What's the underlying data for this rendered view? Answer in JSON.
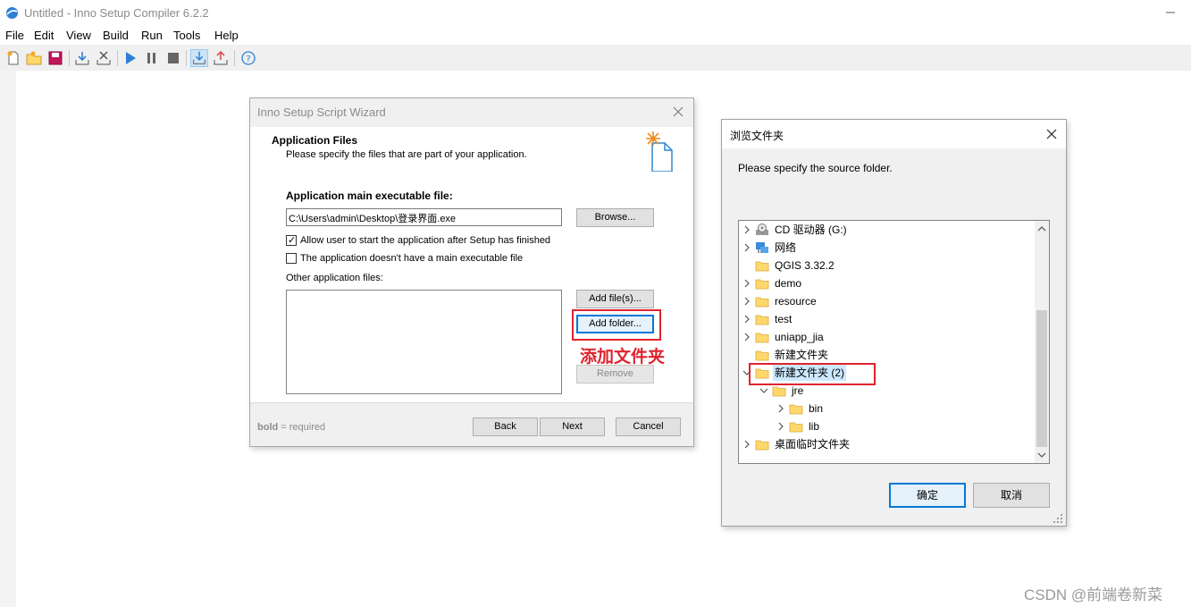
{
  "app": {
    "title": "Untitled - Inno Setup Compiler 6.2.2",
    "menu": [
      "File",
      "Edit",
      "View",
      "Build",
      "Run",
      "Tools",
      "Help"
    ],
    "toolbar_icons": [
      "new-file-icon",
      "open-folder-icon",
      "save-icon",
      "compile-icon",
      "stop-compile-icon",
      "run-icon",
      "pause-icon",
      "stop-icon",
      "load-icon",
      "upload-icon",
      "help-icon"
    ]
  },
  "wizard": {
    "title": "Inno Setup Script Wizard",
    "heading": "Application Files",
    "subheading": "Please specify the files that are part of your application.",
    "main_exe_label": "Application main executable file:",
    "main_exe_value": "C:\\Users\\admin\\Desktop\\登录界面.exe",
    "browse_button": "Browse...",
    "allow_start_label": "Allow user to start the application after Setup has finished",
    "allow_start_checked": true,
    "no_exe_label": "The application doesn't have a main executable file",
    "no_exe_checked": false,
    "other_files_label": "Other application files:",
    "add_files_button": "Add file(s)...",
    "add_folder_button": "Add folder...",
    "remove_button": "Remove",
    "annotation": "添加文件夹",
    "footer_bold": "bold",
    "footer_rest": " = required",
    "back_button": "Back",
    "next_button": "Next",
    "cancel_button": "Cancel"
  },
  "browse": {
    "title": "浏览文件夹",
    "prompt": "Please specify the source folder.",
    "tree": [
      {
        "label": "CD 驱动器 (G:)",
        "icon": "cd-drive-icon",
        "level": 0,
        "chevron": "right"
      },
      {
        "label": "网络",
        "icon": "network-icon",
        "level": 0,
        "chevron": "right"
      },
      {
        "label": "QGIS 3.32.2",
        "icon": "folder-icon",
        "level": 0,
        "chevron": ""
      },
      {
        "label": "demo",
        "icon": "folder-icon",
        "level": 0,
        "chevron": "right"
      },
      {
        "label": "resource",
        "icon": "folder-icon",
        "level": 0,
        "chevron": "right"
      },
      {
        "label": "test",
        "icon": "folder-icon",
        "level": 0,
        "chevron": "right"
      },
      {
        "label": "uniapp_jia",
        "icon": "folder-icon",
        "level": 0,
        "chevron": "right"
      },
      {
        "label": "新建文件夹",
        "icon": "folder-icon",
        "level": 0,
        "chevron": ""
      },
      {
        "label": "新建文件夹 (2)",
        "icon": "folder-icon",
        "level": 0,
        "chevron": "down",
        "selected": true
      },
      {
        "label": "jre",
        "icon": "folder-icon",
        "level": 1,
        "chevron": "down"
      },
      {
        "label": "bin",
        "icon": "folder-icon",
        "level": 2,
        "chevron": "right"
      },
      {
        "label": "lib",
        "icon": "folder-icon",
        "level": 2,
        "chevron": "right"
      },
      {
        "label": "桌面临时文件夹",
        "icon": "folder-icon",
        "level": 0,
        "chevron": "right"
      }
    ],
    "ok_button": "确定",
    "cancel_button": "取消"
  },
  "watermark": "CSDN @前端卷新菜",
  "colors": {
    "highlight_red": "#e0232d",
    "focus_blue": "#0078d7",
    "selection": "#cce8ff",
    "folder": "#ffd86b"
  }
}
